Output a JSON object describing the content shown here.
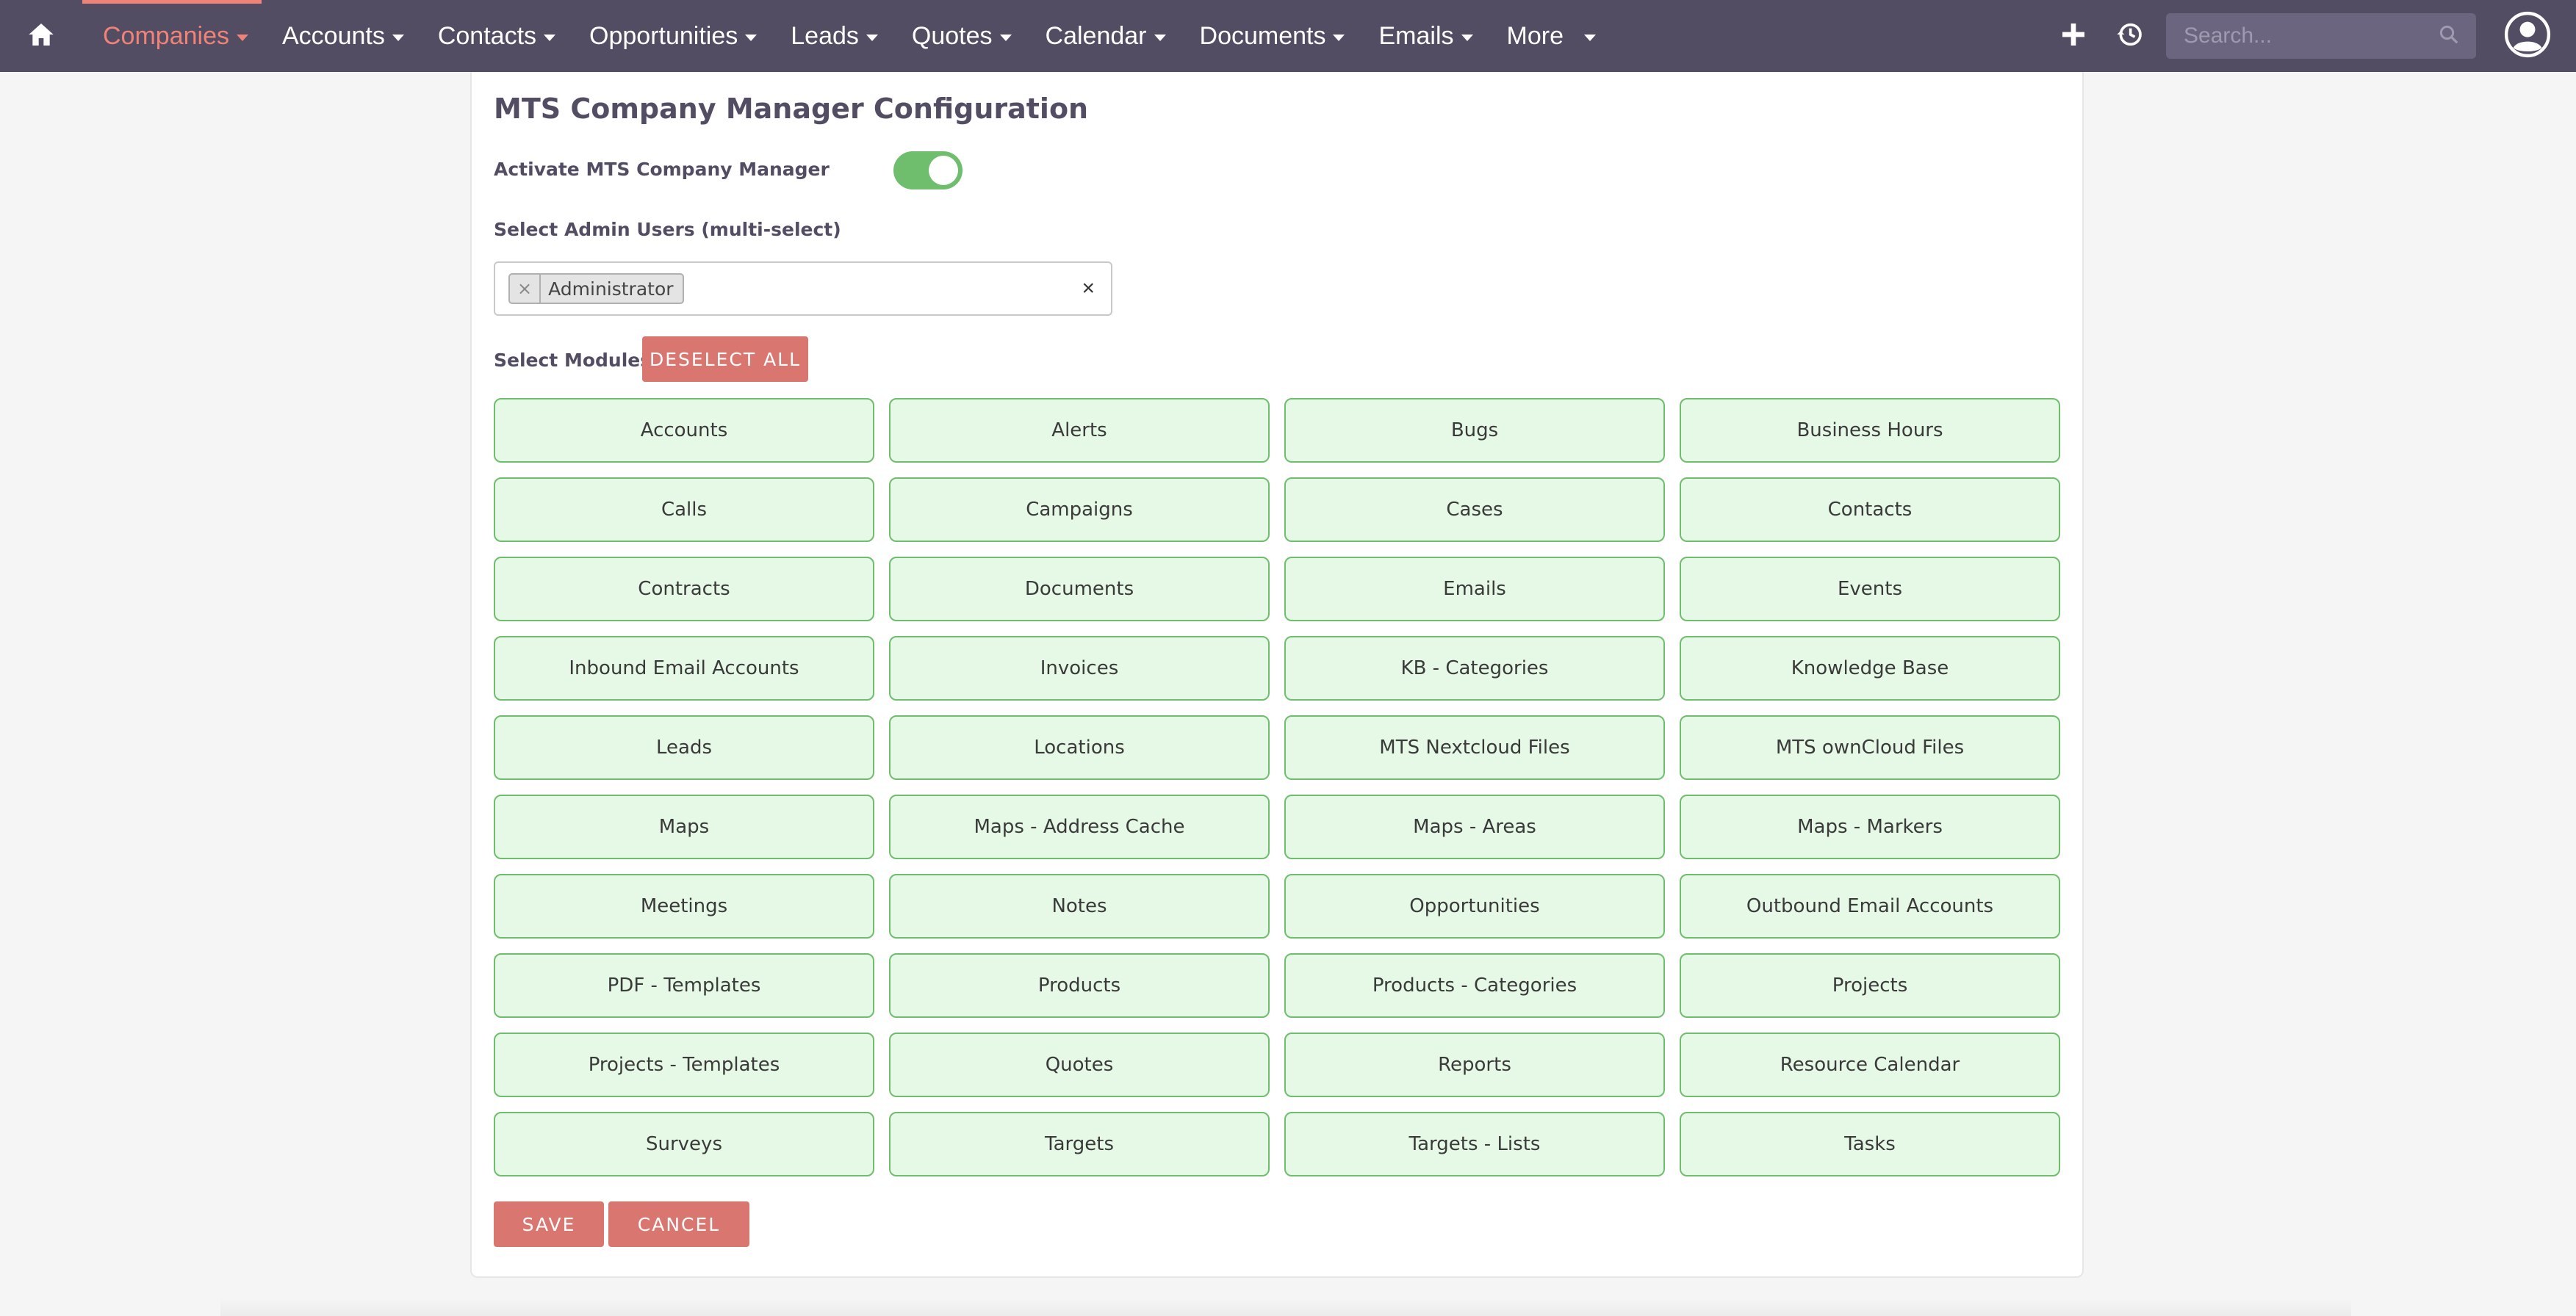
{
  "nav": {
    "items": [
      {
        "label": "Companies",
        "active": true
      },
      {
        "label": "Accounts",
        "active": false
      },
      {
        "label": "Contacts",
        "active": false
      },
      {
        "label": "Opportunities",
        "active": false
      },
      {
        "label": "Leads",
        "active": false
      },
      {
        "label": "Quotes",
        "active": false
      },
      {
        "label": "Calendar",
        "active": false
      },
      {
        "label": "Documents",
        "active": false
      },
      {
        "label": "Emails",
        "active": false
      },
      {
        "label": "More",
        "active": false
      }
    ],
    "search_placeholder": "Search...",
    "icons": [
      "home-icon",
      "plus-icon",
      "history-icon",
      "search-icon",
      "user-icon"
    ]
  },
  "config": {
    "title": "MTS Company Manager Configuration",
    "activate_label": "Activate MTS Company Manager",
    "activate_on": true,
    "admin_users_label": "Select Admin Users (multi-select)",
    "admin_users_selected": [
      "Administrator"
    ],
    "chip_remove": "×",
    "clear_all": "×",
    "modules_label": "Select Modules",
    "deselect_all": "Deselect all",
    "modules": [
      "Accounts",
      "Alerts",
      "Bugs",
      "Business Hours",
      "Calls",
      "Campaigns",
      "Cases",
      "Contacts",
      "Contracts",
      "Documents",
      "Emails",
      "Events",
      "Inbound Email Accounts",
      "Invoices",
      "KB - Categories",
      "Knowledge Base",
      "Leads",
      "Locations",
      "MTS Nextcloud Files",
      "MTS ownCloud Files",
      "Maps",
      "Maps - Address Cache",
      "Maps - Areas",
      "Maps - Markers",
      "Meetings",
      "Notes",
      "Opportunities",
      "Outbound Email Accounts",
      "PDF - Templates",
      "Products",
      "Products - Categories",
      "Projects",
      "Projects - Templates",
      "Quotes",
      "Reports",
      "Resource Calendar",
      "Surveys",
      "Targets",
      "Targets - Lists",
      "Tasks"
    ],
    "save": "Save",
    "cancel": "Cancel"
  },
  "colors": {
    "navbar": "#534d64",
    "accent": "#f08377",
    "button": "#d9766f",
    "module_bg": "#e6f9e6",
    "module_border": "#6ebe6e",
    "toggle_on": "#6ebe6e"
  }
}
